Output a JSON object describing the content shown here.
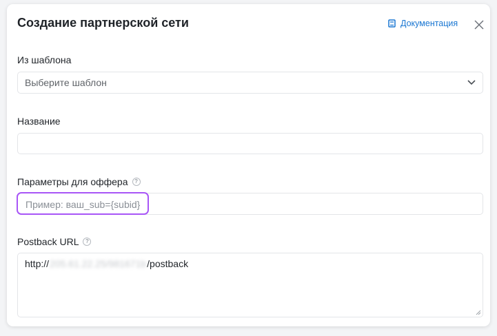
{
  "modal": {
    "title": "Создание партнерской сети",
    "doc_link_label": "Документация"
  },
  "template_field": {
    "label": "Из шаблона",
    "selected_value": "Выберите шаблон"
  },
  "name_field": {
    "label": "Название",
    "value": ""
  },
  "offer_params_field": {
    "label": "Параметры для оффера",
    "placeholder": "Пример: ваш_sub={subid}",
    "value": ""
  },
  "postback_field": {
    "label": "Postback URL",
    "value_prefix": "http://",
    "value_redacted": "205.61.22.25/981671b",
    "value_suffix": "/postback"
  },
  "colors": {
    "link": "#1976d2",
    "focus_ring": "#a855f7",
    "text": "#1f2328"
  }
}
